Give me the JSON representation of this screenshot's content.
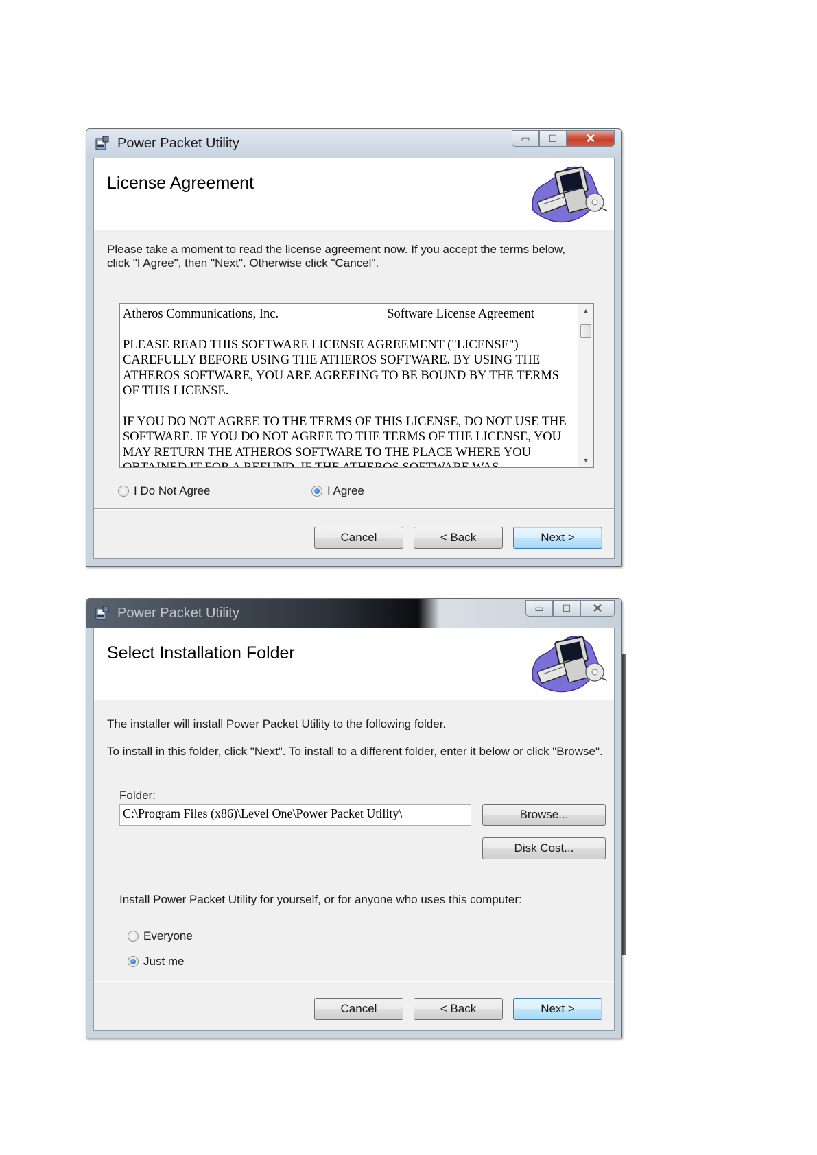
{
  "windows": [
    {
      "title": "Power Packet Utility",
      "banner_title": "License Agreement",
      "intro": "Please take a moment to read the license agreement now. If you accept the terms below, click \"I Agree\", then \"Next\". Otherwise click \"Cancel\".",
      "license": {
        "company": "Atheros Communications, Inc.",
        "doc_title": "Software License Agreement",
        "para1": "PLEASE READ THIS SOFTWARE LICENSE AGREEMENT (\"LICENSE\") CAREFULLY BEFORE USING THE ATHEROS SOFTWARE.  BY USING THE ATHEROS SOFTWARE, YOU ARE AGREEING TO BE BOUND BY THE TERMS OF THIS LICENSE.",
        "para2": "IF YOU DO NOT AGREE TO THE TERMS OF THIS LICENSE, DO NOT USE THE SOFTWARE.  IF YOU DO NOT AGREE TO THE TERMS OF THE LICENSE, YOU MAY RETURN THE ATHEROS SOFTWARE TO THE PLACE WHERE YOU OBTAINED IT FOR A REFUND.  IF THE ATHEROS SOFTWARE WAS"
      },
      "radio_disagree": "I Do Not Agree",
      "radio_agree": "I Agree",
      "selected": "I Agree",
      "cancel": "Cancel",
      "back": "< Back",
      "next": "Next >"
    },
    {
      "title": "Power Packet Utility",
      "banner_title": "Select Installation Folder",
      "line1": "The installer will install Power Packet Utility  to the following folder.",
      "line2": "To install in this folder, click \"Next\". To install to a different folder, enter it below or click \"Browse\".",
      "folder_label": "Folder:",
      "folder_value": "C:\\Program Files (x86)\\Level One\\Power Packet Utility\\",
      "browse": "Browse...",
      "disk_cost": "Disk Cost...",
      "install_for": "Install Power Packet Utility  for yourself, or for anyone who uses this computer:",
      "radio_everyone": "Everyone",
      "radio_justme": "Just me",
      "selected": "Just me",
      "cancel": "Cancel",
      "back": "< Back",
      "next": "Next >"
    }
  ],
  "colors": {
    "close_button": "#c7402c",
    "default_button": "#3c7fb1",
    "radio_selected": "#1f5fbf"
  },
  "icons": [
    "installer-app-icon",
    "computer-cd-banner-icon",
    "minimize-icon",
    "maximize-icon",
    "close-icon"
  ]
}
